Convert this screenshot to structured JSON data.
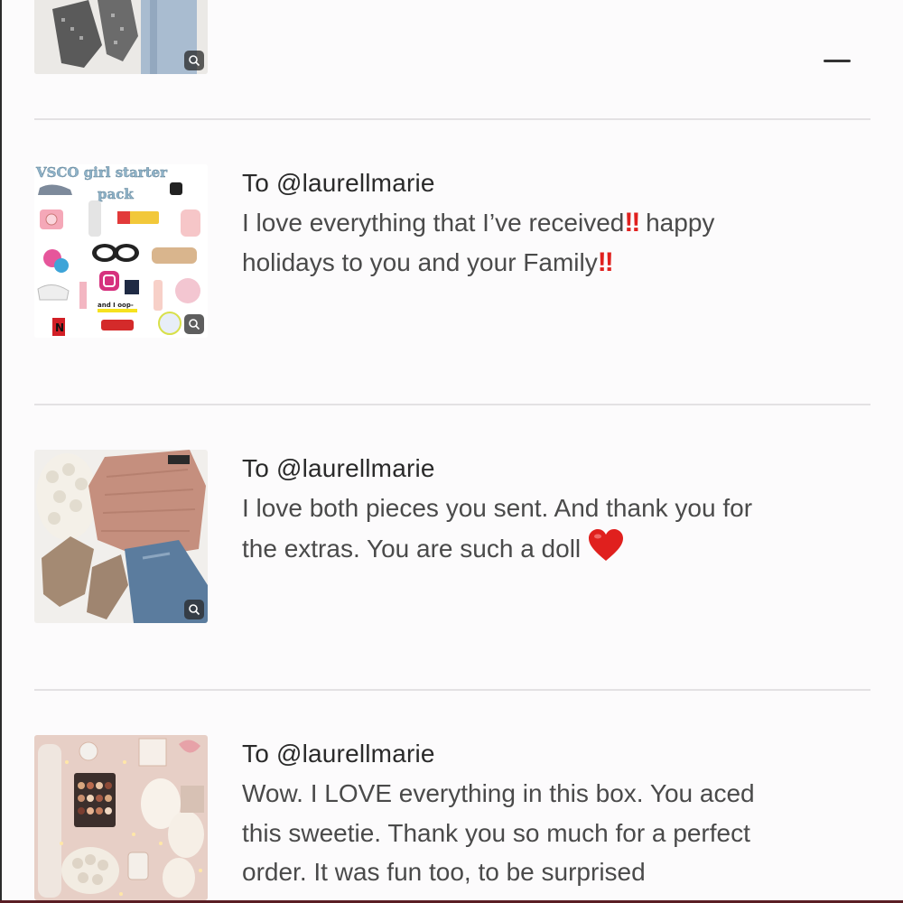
{
  "orders": [
    {
      "recipient": "",
      "message_lines": [],
      "thumbnail_icon": "outfit-boots-jeans-thumbnail"
    },
    {
      "recipient": "To @laurellmarie",
      "message_lines": [
        "I love everything that I’ve received",
        " happy",
        "holidays to you and your Family"
      ],
      "thumbnail_icon": "vsco-girl-starter-pack-thumbnail",
      "thumbnail_text": {
        "line1": "VSCO girl starter",
        "line2": "pack",
        "line3": "and I oop-"
      },
      "emoji": "double-exclamation-icon",
      "emoji_glyph": "!!"
    },
    {
      "recipient": "To @laurellmarie",
      "message_lines": [
        "I love both pieces you sent. And thank you for",
        "the extras. You are such a doll "
      ],
      "thumbnail_icon": "sweater-boots-jeans-thumbnail",
      "emoji": "red-heart-icon"
    },
    {
      "recipient": "To @laurellmarie",
      "message_lines": [
        "Wow. I LOVE everything in this box. You aced",
        "this sweetie. Thank you so much for a perfect",
        "order. It was fun too, to be surprised"
      ],
      "thumbnail_icon": "cozy-gift-box-thumbnail"
    }
  ],
  "colors": {
    "background": "#fcfbfc",
    "divider": "#e3e1e3",
    "accent_red": "#e0201e"
  }
}
